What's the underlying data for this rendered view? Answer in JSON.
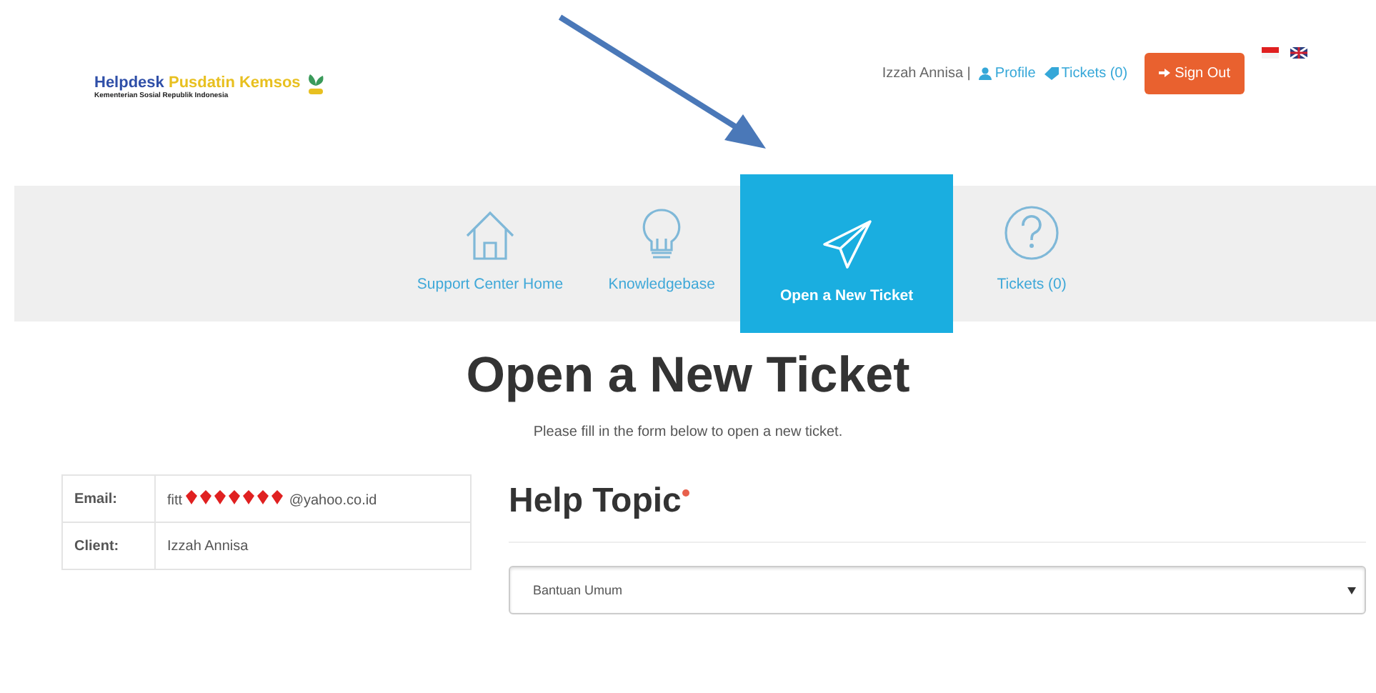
{
  "logo": {
    "title_parts": [
      {
        "text": "Helpdesk",
        "color": "#2f4fa8"
      },
      {
        "text": "Pusdatin Kemsos",
        "color": "#e8c020"
      }
    ],
    "subtitle": "Kementerian Sosial Republik Indonesia"
  },
  "user_bar": {
    "user_name": "Izzah Annisa |",
    "links": [
      {
        "kind": "profile",
        "label": "Profile"
      },
      {
        "kind": "tickets",
        "label": "Tickets (0)"
      }
    ],
    "sign_out": "Sign Out",
    "flags": [
      {
        "kind": "id"
      },
      {
        "kind": "uk"
      }
    ]
  },
  "nav": [
    {
      "kind": "home",
      "label": "Support Center Home",
      "selected": false
    },
    {
      "kind": "bulb",
      "label": "Knowledgebase",
      "selected": false
    },
    {
      "kind": "plane",
      "label": "Open a New Ticket",
      "selected": true
    },
    {
      "kind": "question",
      "label": "Tickets (0)",
      "selected": false
    }
  ],
  "page": {
    "title": "Open a New Ticket",
    "subtitle": "Please fill in the form below to open a new ticket."
  },
  "info": [
    {
      "label": "Email:",
      "value_start": "fitt",
      "redacted": true,
      "value_end": "@yahoo.co.id"
    },
    {
      "label": "Client:",
      "value_start": "Izzah Annisa",
      "redacted": false
    }
  ],
  "help_topic": {
    "heading": "Help Topic",
    "required": true,
    "value": "Bantuan Umum"
  }
}
